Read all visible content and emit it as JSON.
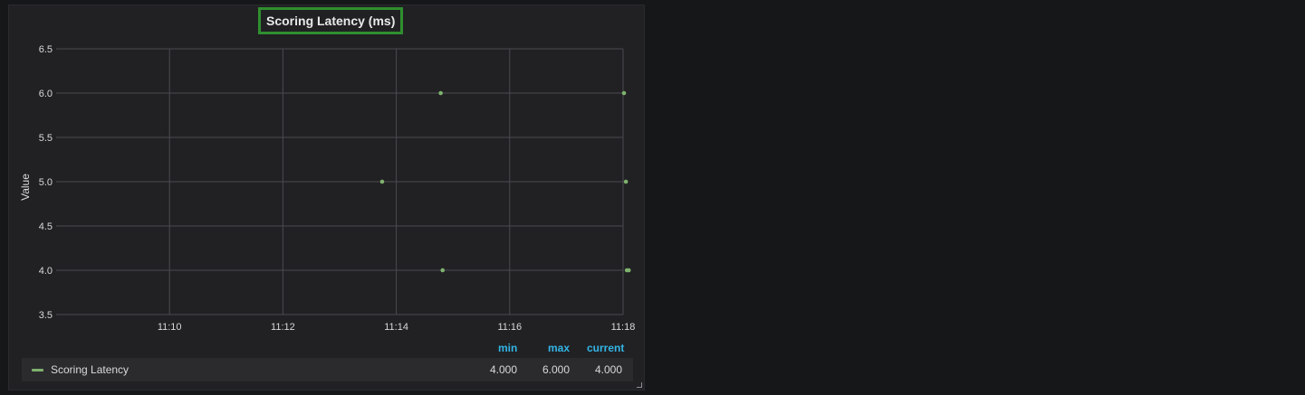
{
  "panel": {
    "title": "Scoring Latency (ms)"
  },
  "chart_data": {
    "type": "scatter",
    "title": "Scoring Latency (ms)",
    "ylabel": "Value",
    "xlabel": "",
    "ylim": [
      3.5,
      6.5
    ],
    "yticks": [
      "3.5",
      "4.0",
      "4.5",
      "5.0",
      "5.5",
      "6.0",
      "6.5"
    ],
    "xticks": [
      "11:10",
      "11:12",
      "11:14",
      "11:16",
      "11:18"
    ],
    "xlim": [
      "11:08",
      "11:18"
    ],
    "grid": true,
    "series": [
      {
        "name": "Scoring Latency",
        "color": "#7eb26d",
        "points": [
          {
            "x": "11:13:45",
            "y": 5.0
          },
          {
            "x": "11:14:47",
            "y": 6.0
          },
          {
            "x": "11:14:49",
            "y": 4.0
          },
          {
            "x": "11:18:01",
            "y": 6.0
          },
          {
            "x": "11:18:03",
            "y": 5.0
          },
          {
            "x": "11:18:04",
            "y": 4.0
          },
          {
            "x": "11:18:06",
            "y": 4.0
          }
        ]
      }
    ]
  },
  "legend": {
    "headers": {
      "min": "min",
      "max": "max",
      "current": "current"
    },
    "series_name": "Scoring Latency",
    "min": "4.000",
    "max": "6.000",
    "current": "4.000",
    "swatch_color": "#7eb26d"
  }
}
